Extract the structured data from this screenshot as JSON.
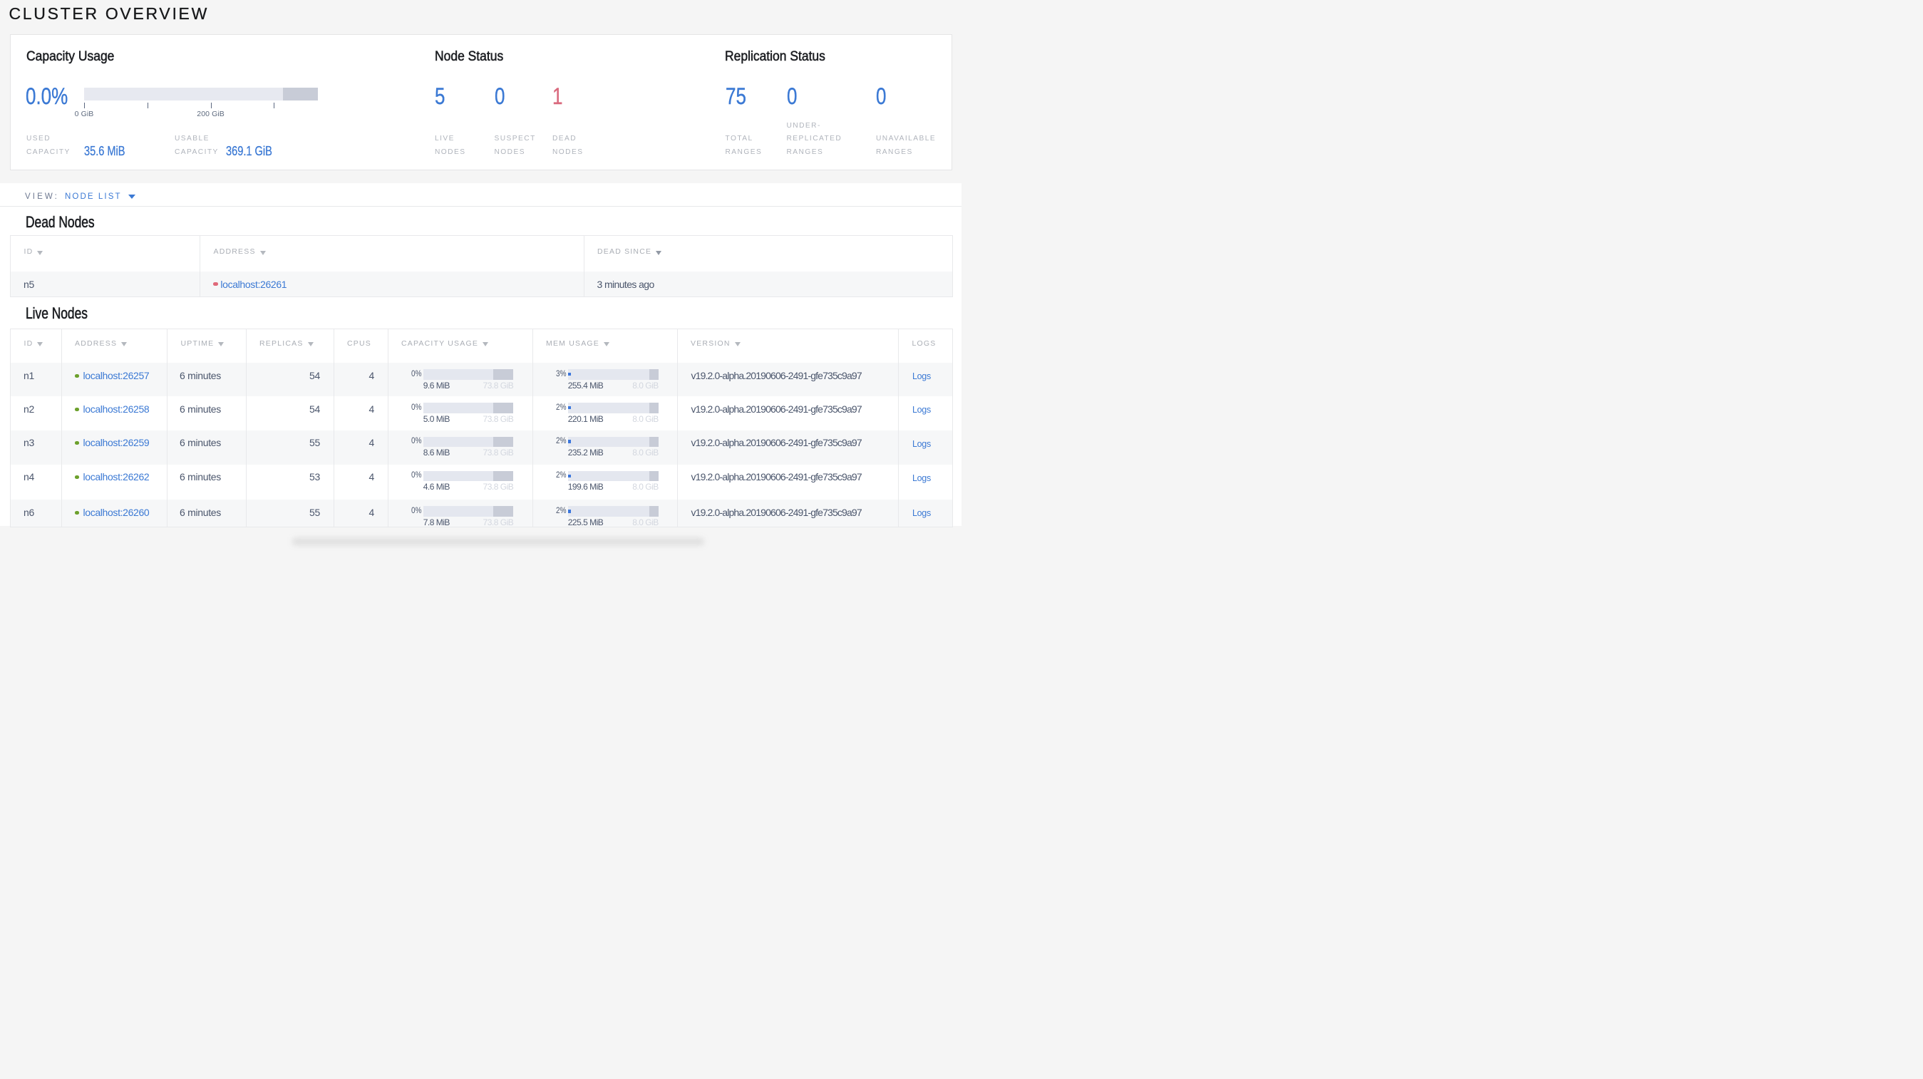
{
  "title": "CLUSTER OVERVIEW",
  "colors": {
    "accent_blue": "#3b79d4",
    "dead_red": "#d9697d",
    "live_green": "#6ca02c",
    "text_dark": "#4b566c",
    "label_gray": "#b0b4bc",
    "bar_track": "#e4e7ef",
    "bar_other": "#c8ccd7",
    "page_bg": "#f5f5f5"
  },
  "overview": {
    "capacity": {
      "heading": "Capacity Usage",
      "percent": "0.0%",
      "axis": {
        "tick_labels": [
          "0 GiB",
          "",
          "200 GiB",
          ""
        ],
        "other_start_frac": 0.85
      },
      "stats": [
        {
          "label_lines": [
            "USED",
            "CAPACITY"
          ],
          "value": "35.6 MiB"
        },
        {
          "label_lines": [
            "USABLE",
            "CAPACITY"
          ],
          "value": "369.1 GiB"
        }
      ]
    },
    "node_status": {
      "heading": "Node Status",
      "stats": [
        {
          "value": "5",
          "tone": "blue",
          "label_lines": [
            "LIVE",
            "NODES"
          ]
        },
        {
          "value": "0",
          "tone": "blue",
          "label_lines": [
            "SUSPECT",
            "NODES"
          ]
        },
        {
          "value": "1",
          "tone": "red",
          "label_lines": [
            "DEAD",
            "NODES"
          ]
        }
      ]
    },
    "replication": {
      "heading": "Replication Status",
      "stats": [
        {
          "value": "75",
          "tone": "blue",
          "label_lines": [
            "TOTAL",
            "RANGES"
          ]
        },
        {
          "value": "0",
          "tone": "blue",
          "label_lines": [
            "UNDER-",
            "REPLICATED",
            "RANGES"
          ]
        },
        {
          "value": "0",
          "tone": "blue",
          "label_lines": [
            "UNAVAILABLE",
            "RANGES"
          ]
        }
      ]
    }
  },
  "view_bar": {
    "label": "VIEW:",
    "selected": "NODE LIST",
    "caret_icon": "triangle-down-icon"
  },
  "dead_nodes": {
    "heading": "Dead Nodes",
    "columns": [
      {
        "label": "ID",
        "sorted": false
      },
      {
        "label": "ADDRESS",
        "sorted": false
      },
      {
        "label": "DEAD SINCE",
        "sorted": true
      }
    ],
    "rows": [
      {
        "id": "n5",
        "address": "localhost:26261",
        "dead_since": "3 minutes ago"
      }
    ]
  },
  "live_nodes": {
    "heading": "Live Nodes",
    "columns": [
      {
        "label": "ID",
        "sorted": false,
        "sortable": true
      },
      {
        "label": "ADDRESS",
        "sorted": false,
        "sortable": true
      },
      {
        "label": "UPTIME",
        "sorted": false,
        "sortable": true
      },
      {
        "label": "REPLICAS",
        "sorted": false,
        "sortable": true,
        "numeric": true
      },
      {
        "label": "CPUS",
        "sorted": false,
        "sortable": false,
        "numeric": true
      },
      {
        "label": "CAPACITY USAGE",
        "sorted": false,
        "sortable": true
      },
      {
        "label": "MEM USAGE",
        "sorted": false,
        "sortable": true
      },
      {
        "label": "VERSION",
        "sorted": false,
        "sortable": true
      },
      {
        "label": "LOGS",
        "sorted": false,
        "sortable": false
      }
    ],
    "rows": [
      {
        "id": "n1",
        "address": "localhost:26257",
        "uptime": "6 minutes",
        "replicas": "54",
        "cpus": "4",
        "capacity": {
          "percent": "0%",
          "used": "9.6 MiB",
          "total": "73.8 GiB",
          "used_frac": 0.0,
          "other_start_frac": 0.779
        },
        "memory": {
          "percent": "3%",
          "used": "255.4 MiB",
          "total": "8.0 GiB",
          "used_frac": 0.031,
          "other_start_frac": 0.901
        },
        "version": "v19.2.0-alpha.20190606-2491-gfe735c9a97",
        "logs_label": "Logs"
      },
      {
        "id": "n2",
        "address": "localhost:26258",
        "uptime": "6 minutes",
        "replicas": "54",
        "cpus": "4",
        "capacity": {
          "percent": "0%",
          "used": "5.0 MiB",
          "total": "73.8 GiB",
          "used_frac": 0.0,
          "other_start_frac": 0.779
        },
        "memory": {
          "percent": "2%",
          "used": "220.1 MiB",
          "total": "8.0 GiB",
          "used_frac": 0.027,
          "other_start_frac": 0.901
        },
        "version": "v19.2.0-alpha.20190606-2491-gfe735c9a97",
        "logs_label": "Logs"
      },
      {
        "id": "n3",
        "address": "localhost:26259",
        "uptime": "6 minutes",
        "replicas": "55",
        "cpus": "4",
        "capacity": {
          "percent": "0%",
          "used": "8.6 MiB",
          "total": "73.8 GiB",
          "used_frac": 0.0,
          "other_start_frac": 0.779
        },
        "memory": {
          "percent": "2%",
          "used": "235.2 MiB",
          "total": "8.0 GiB",
          "used_frac": 0.029,
          "other_start_frac": 0.901
        },
        "version": "v19.2.0-alpha.20190606-2491-gfe735c9a97",
        "logs_label": "Logs"
      },
      {
        "id": "n4",
        "address": "localhost:26262",
        "uptime": "6 minutes",
        "replicas": "53",
        "cpus": "4",
        "capacity": {
          "percent": "0%",
          "used": "4.6 MiB",
          "total": "73.8 GiB",
          "used_frac": 0.0,
          "other_start_frac": 0.779
        },
        "memory": {
          "percent": "2%",
          "used": "199.6 MiB",
          "total": "8.0 GiB",
          "used_frac": 0.025,
          "other_start_frac": 0.901
        },
        "version": "v19.2.0-alpha.20190606-2491-gfe735c9a97",
        "logs_label": "Logs"
      },
      {
        "id": "n6",
        "address": "localhost:26260",
        "uptime": "6 minutes",
        "replicas": "55",
        "cpus": "4",
        "capacity": {
          "percent": "0%",
          "used": "7.8 MiB",
          "total": "73.8 GiB",
          "used_frac": 0.0,
          "other_start_frac": 0.779
        },
        "memory": {
          "percent": "2%",
          "used": "225.5 MiB",
          "total": "8.0 GiB",
          "used_frac": 0.028,
          "other_start_frac": 0.901
        },
        "version": "v19.2.0-alpha.20190606-2491-gfe735c9a97",
        "logs_label": "Logs"
      }
    ]
  }
}
